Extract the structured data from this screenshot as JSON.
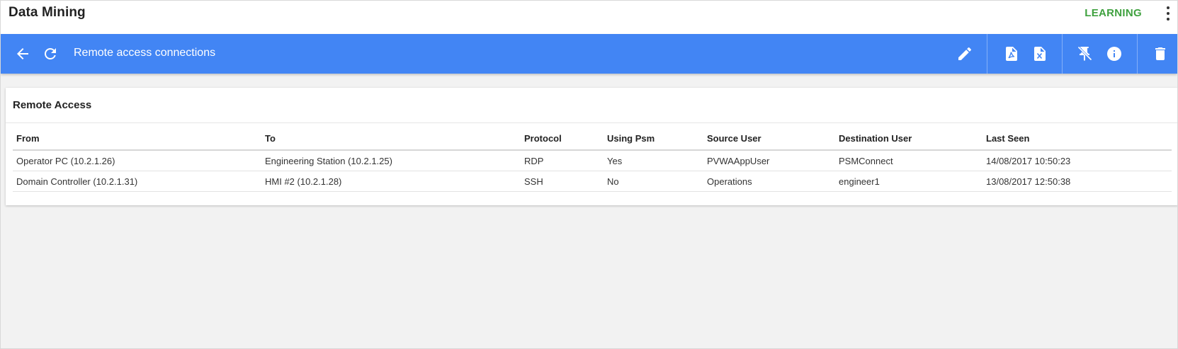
{
  "app": {
    "title": "Data Mining",
    "mode": "LEARNING"
  },
  "toolbar": {
    "title": "Remote access connections",
    "icons": {
      "back": "arrow-back-icon",
      "refresh": "refresh-icon",
      "edit": "pencil-icon",
      "pdf": "pdf-file-icon",
      "excel": "excel-file-icon",
      "unpin": "unpin-icon",
      "info": "info-icon",
      "delete": "trash-icon"
    }
  },
  "card": {
    "title": "Remote Access",
    "columns": [
      "From",
      "To",
      "Protocol",
      "Using Psm",
      "Source User",
      "Destination User",
      "Last Seen"
    ],
    "rows": [
      [
        "Operator PC (10.2.1.26)",
        "Engineering Station (10.2.1.25)",
        "RDP",
        "Yes",
        "PVWAAppUser",
        "PSMConnect",
        "14/08/2017 10:50:23"
      ],
      [
        "Domain Controller (10.2.1.31)",
        "HMI #2 (10.2.1.28)",
        "SSH",
        "No",
        "Operations",
        "engineer1",
        "13/08/2017 12:50:38"
      ]
    ]
  },
  "colors": {
    "toolbar": "#4285f4",
    "mode": "#3fa13f",
    "background": "#f2f2f2"
  }
}
